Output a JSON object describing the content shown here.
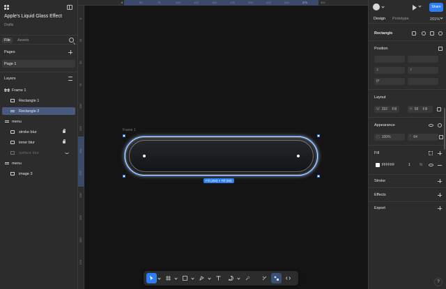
{
  "file": {
    "title": "Apple's Liquid Glass Effect",
    "subtitle": "Drafts"
  },
  "left_tabs": {
    "file": "File",
    "assets": "Assets"
  },
  "pages": {
    "title": "Pages",
    "items": [
      "Page 1"
    ]
  },
  "layers": {
    "title": "Layers",
    "items": [
      {
        "label": "Frame 1"
      },
      {
        "label": "Rectangle 1"
      },
      {
        "label": "Rectangle 2"
      },
      {
        "label": "menu"
      },
      {
        "label": "stroke blur"
      },
      {
        "label": "inner blur"
      },
      {
        "label": "surface blur"
      },
      {
        "label": "menu"
      },
      {
        "label": "image 3"
      }
    ]
  },
  "ruler_h": {
    "ticks": [
      "0",
      "50",
      "75",
      "100",
      "125",
      "150",
      "175",
      "200",
      "225",
      "250",
      "279",
      "300"
    ],
    "selected": [
      "0",
      "279"
    ]
  },
  "ruler_v": {
    "ticks": [
      "0",
      "25",
      "50",
      "75",
      "100",
      "125",
      "150",
      "175",
      "200",
      "225",
      "250",
      "275"
    ],
    "selected": [
      "0",
      "58"
    ]
  },
  "canvas": {
    "frame_label": "Frame 1",
    "dimensions": "Fill (292) × Fill (58)"
  },
  "header_right": {
    "share": "Share",
    "tabs": {
      "design": "Design",
      "prototype": "Prototype"
    },
    "zoom": "201%"
  },
  "design": {
    "layer_type": "Rectangle",
    "position": {
      "title": "Position",
      "x_label": "X",
      "y_label": "Y",
      "rotation": "0°"
    },
    "layout": {
      "title": "Layout",
      "w_label": "W",
      "w_value": "292",
      "w_mode": "Fill",
      "h_label": "H",
      "h_value": "58",
      "h_mode": "Fill"
    },
    "appearance": {
      "title": "Appearance",
      "opacity": "100%",
      "radius": "64"
    },
    "fill": {
      "title": "Fill",
      "hex": "FFFFFF",
      "alpha": "1",
      "unit": "%"
    },
    "stroke": {
      "title": "Stroke"
    },
    "effects": {
      "title": "Effects"
    },
    "export": {
      "title": "Export"
    }
  },
  "help": "?",
  "colors": {
    "accent": "#2d7df6",
    "panel": "#2c2c2c",
    "canvas": "#141414"
  }
}
